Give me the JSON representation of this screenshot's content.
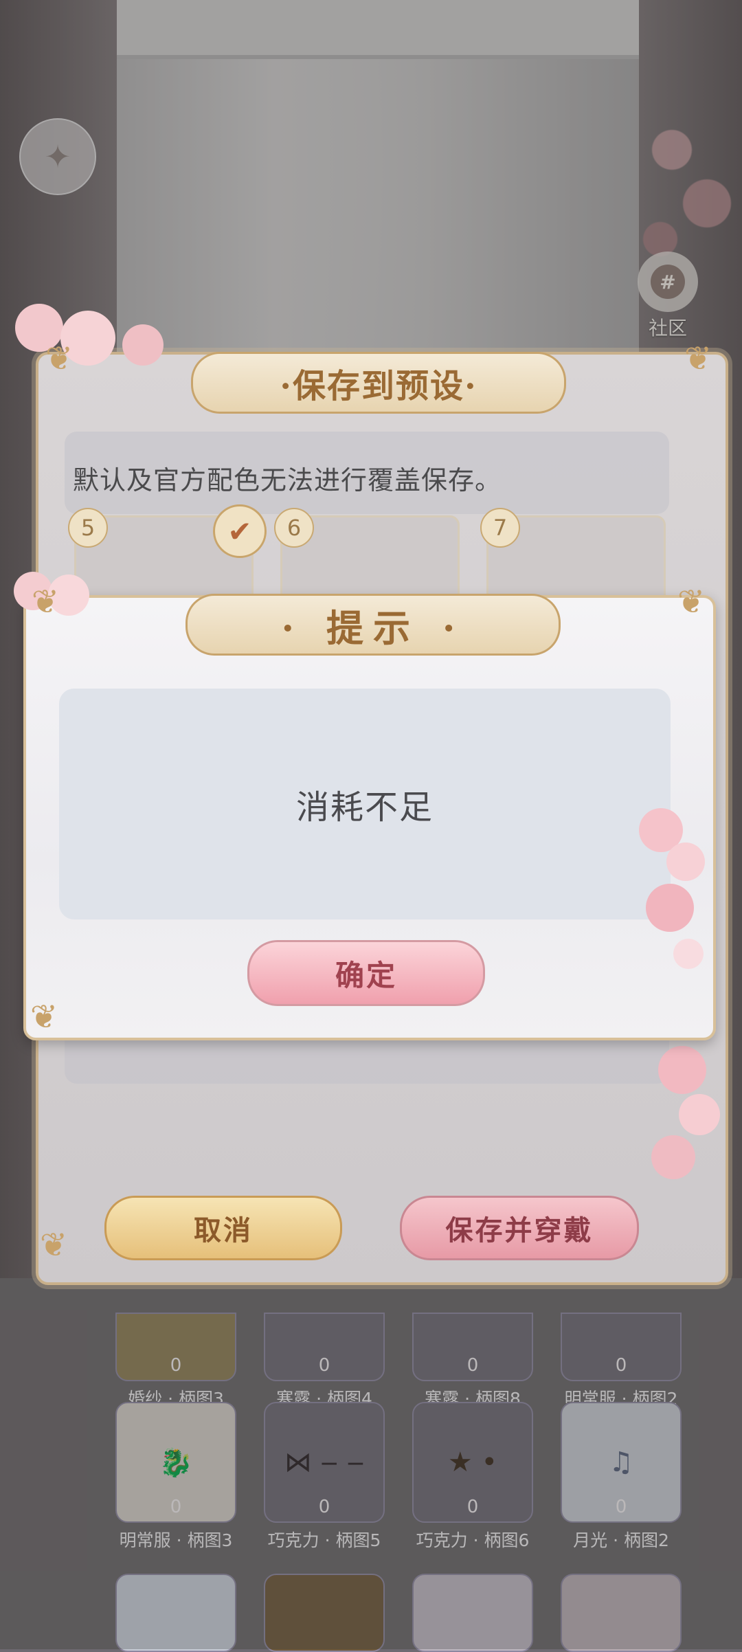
{
  "background": {
    "back_icon": "compass-arrow-icon",
    "community": {
      "icon_text": "#",
      "label": "社区"
    },
    "grid": {
      "rows": [
        [
          {
            "count": "0",
            "name": "婚纱 · 柄图3"
          },
          {
            "count": "0",
            "name": "寒露 · 柄图4"
          },
          {
            "count": "0",
            "name": "寒露 · 柄图8"
          },
          {
            "count": "0",
            "name": "明常服 · 柄图2"
          }
        ],
        [
          {
            "count": "0",
            "name": "明常服 · 柄图3",
            "glyph": "🐉"
          },
          {
            "count": "0",
            "name": "巧克力 · 柄图5",
            "glyph": "⋈ ‒ ‒"
          },
          {
            "count": "0",
            "name": "巧克力 · 柄图6",
            "glyph": "★ •"
          },
          {
            "count": "0",
            "name": "月光 · 柄图2",
            "glyph": "♫"
          }
        ]
      ]
    }
  },
  "save_dialog": {
    "title": "·保存到预设·",
    "message": "默认及官方配色无法进行覆盖保存。",
    "slots": [
      "5",
      "6",
      "7"
    ],
    "selected_icon": "✔",
    "cancel_label": "取消",
    "save_wear_label": "保存并穿戴"
  },
  "hint_dialog": {
    "title": "· 提示 ·",
    "message": "消耗不足",
    "confirm_label": "确定"
  },
  "colors": {
    "gold": "#c8a46c",
    "pink": "#f0a0ad"
  }
}
